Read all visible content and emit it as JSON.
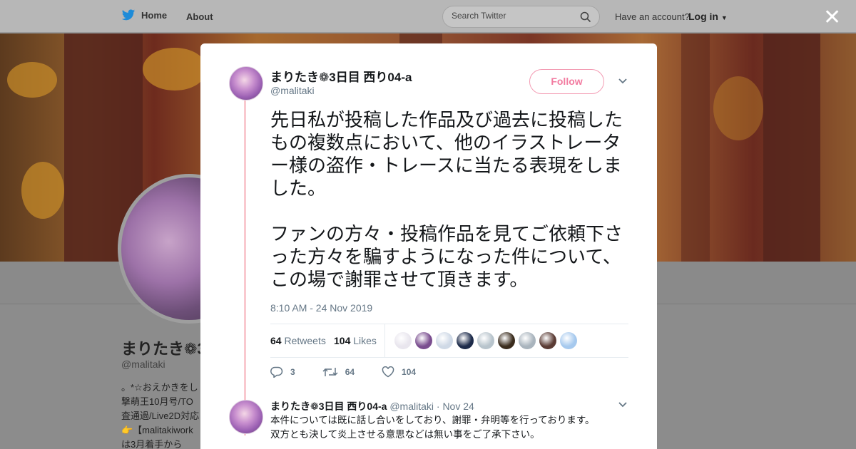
{
  "nav": {
    "home_label": "Home",
    "about_label": "About",
    "search_placeholder": "Search Twitter",
    "have_account": "Have an account?",
    "login_label": "Log in",
    "close_glyph": "✕"
  },
  "profile": {
    "name": "まりたき❁3",
    "handle": "@malitaki",
    "bio_lines": [
      "。*☆おえかきをし",
      "撃萌王10月号/TO",
      "査通過/Live2D対応",
      "👉【malitakiwork",
      "は3月着手から"
    ]
  },
  "tweet": {
    "author_name": "まりたき❁3日目 西り04-a",
    "author_handle": "@malitaki",
    "follow_label": "Follow",
    "text": "先日私が投稿した作品及び過去に投稿したもの複数点において、他のイラストレーター様の盗作・トレースに当たる表現をしました。\n\nファンの方々・投稿作品を見てご依頼下さった方々を騙すようになった件について、この場で謝罪させて頂きます。",
    "timestamp": "8:10 AM - 24 Nov 2019",
    "retweets_count": "64",
    "retweets_label": "Retweets",
    "likes_count": "104",
    "likes_label": "Likes",
    "liker_colors": [
      "#e9e6ee",
      "#7a4e8f",
      "#cfd9e6",
      "#1d2b4a",
      "#b8c4cc",
      "#3a2c1d",
      "#a9b4bd",
      "#5a3b34",
      "#a6c9ee"
    ],
    "actions": {
      "reply_count": "3",
      "retweet_count": "64",
      "like_count": "104"
    }
  },
  "reply": {
    "author_name": "まりたき❁3日目 西り04-a",
    "author_handle": "@malitaki",
    "date": "· Nov 24",
    "line1": "本件については既に話し合いをしており、謝罪・弁明等を行っております。",
    "line2": "双方とも決して炎上させる意思などは無い事をご了承下さい。"
  },
  "colors": {
    "accent_pink": "#f27ba0",
    "thread_line": "#f9c9cf",
    "muted": "#657786"
  }
}
